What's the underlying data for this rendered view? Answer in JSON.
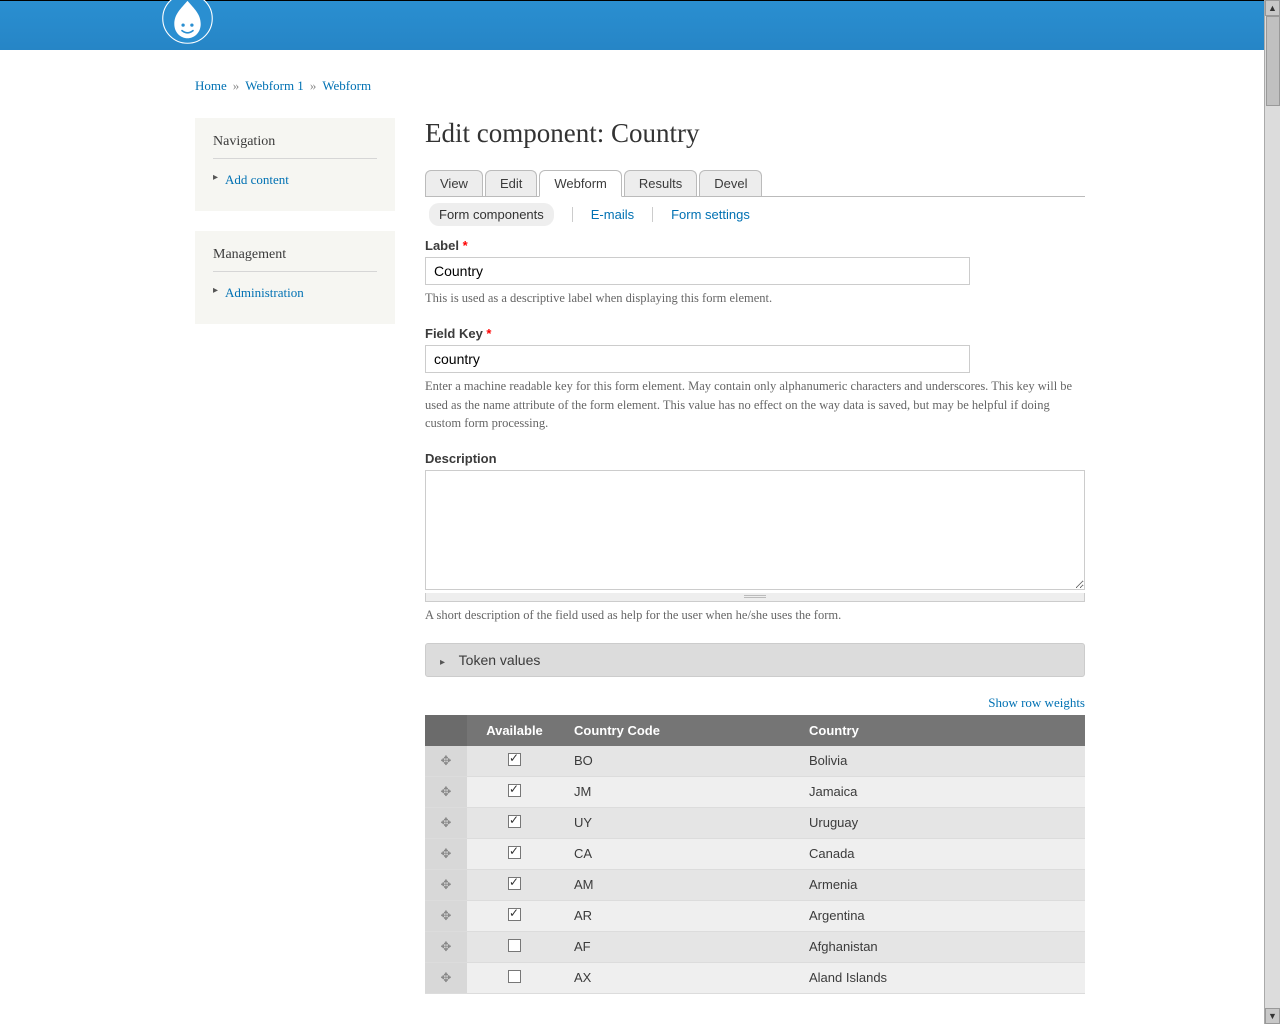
{
  "breadcrumb": [
    {
      "label": "Home"
    },
    {
      "label": "Webform 1"
    },
    {
      "label": "Webform"
    }
  ],
  "sidebar": {
    "nav": {
      "title": "Navigation",
      "items": [
        {
          "label": "Add content"
        }
      ]
    },
    "mgmt": {
      "title": "Management",
      "items": [
        {
          "label": "Administration"
        }
      ]
    }
  },
  "page_title": "Edit component: Country",
  "tabs_primary": [
    {
      "label": "View",
      "active": false
    },
    {
      "label": "Edit",
      "active": false
    },
    {
      "label": "Webform",
      "active": true
    },
    {
      "label": "Results",
      "active": false
    },
    {
      "label": "Devel",
      "active": false
    }
  ],
  "tabs_secondary": [
    {
      "label": "Form components",
      "active": true
    },
    {
      "label": "E-mails",
      "active": false
    },
    {
      "label": "Form settings",
      "active": false
    }
  ],
  "form": {
    "label_label": "Label",
    "label_value": "Country",
    "label_desc": "This is used as a descriptive label when displaying this form element.",
    "fieldkey_label": "Field Key",
    "fieldkey_value": "country",
    "fieldkey_desc": "Enter a machine readable key for this form element. May contain only alphanumeric characters and underscores. This key will be used as the name attribute of the form element. This value has no effect on the way data is saved, but may be helpful if doing custom form processing.",
    "description_label": "Description",
    "description_value": "",
    "description_desc": "A short description of the field used as help for the user when he/she uses the form."
  },
  "token_fieldset": "Token values",
  "show_row_weights": "Show row weights",
  "table": {
    "headers": {
      "available": "Available",
      "code": "Country Code",
      "country": "Country"
    },
    "rows": [
      {
        "available": true,
        "code": "BO",
        "country": "Bolivia"
      },
      {
        "available": true,
        "code": "JM",
        "country": "Jamaica"
      },
      {
        "available": true,
        "code": "UY",
        "country": "Uruguay"
      },
      {
        "available": true,
        "code": "CA",
        "country": "Canada"
      },
      {
        "available": true,
        "code": "AM",
        "country": "Armenia"
      },
      {
        "available": true,
        "code": "AR",
        "country": "Argentina"
      },
      {
        "available": false,
        "code": "AF",
        "country": "Afghanistan"
      },
      {
        "available": false,
        "code": "AX",
        "country": "Aland Islands"
      }
    ]
  }
}
